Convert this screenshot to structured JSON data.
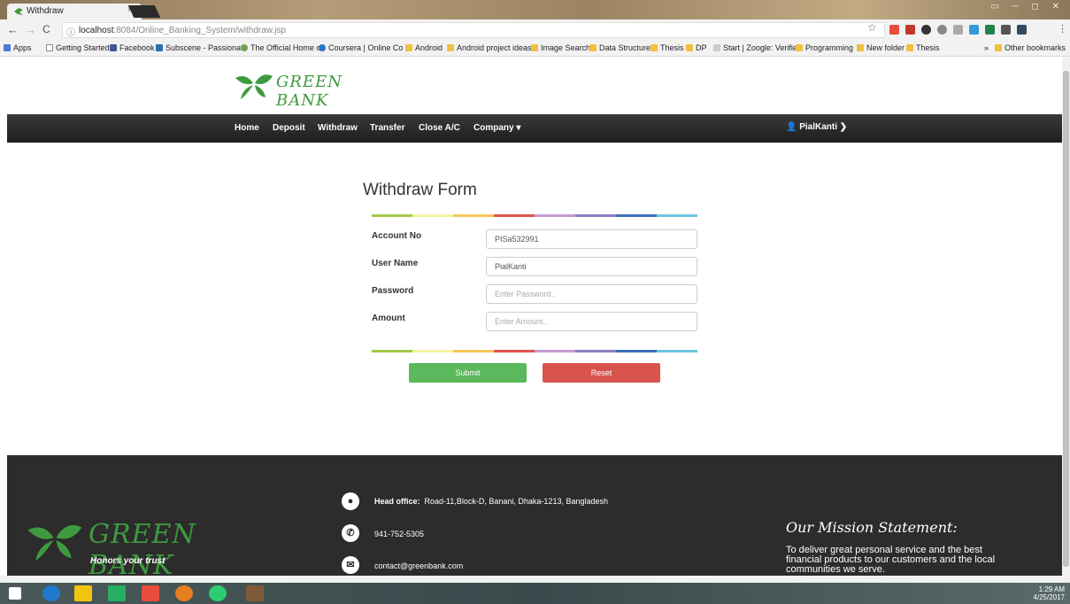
{
  "browser": {
    "tab_title": "Withdraw",
    "tab_close": "×",
    "window_controls": "▭ ─ ◻ ✕",
    "url_host": "localhost",
    "url_path": ":8084/Online_Banking_System/withdraw.jsp",
    "bookmarks": [
      "Apps",
      "Getting Started",
      "Facebook",
      "Subscene - Passionate",
      "The Official Home of",
      "Coursera | Online Co",
      "Android",
      "Android project ideas",
      "Image Search",
      "Data Structure",
      "Thesis",
      "DP",
      "Start | Zoogle: Verifie",
      "Programming",
      "New folder",
      "Thesis"
    ],
    "bookmarks_overflow": "»",
    "other_bookmarks": "Other bookmarks"
  },
  "header": {
    "logo_text": "GREEN BANK"
  },
  "nav": {
    "items": [
      "Home",
      "Deposit",
      "Withdraw",
      "Transfer",
      "Close A/C",
      "Company ▾"
    ],
    "user": "PialKanti ❯"
  },
  "form": {
    "title": "Withdraw Form",
    "fields": [
      {
        "label": "Account No",
        "value": "PISa532991",
        "placeholder": ""
      },
      {
        "label": "User Name",
        "value": "PialKanti",
        "placeholder": ""
      },
      {
        "label": "Password",
        "value": "",
        "placeholder": "Enter Password.."
      },
      {
        "label": "Amount",
        "value": "",
        "placeholder": "Enter Amount.."
      }
    ],
    "submit_label": "Submit",
    "reset_label": "Reset"
  },
  "footer": {
    "logo_text": "GREEN BANK",
    "tagline": "Honors your trust",
    "head_office_label": "Head office:",
    "head_office_address": "Road-11,Block-D, Banani, Dhaka-1213, Bangladesh",
    "phone": "941-752-5305",
    "email": "contact@greenbank.com",
    "mission_title": "Our Mission Statement:",
    "mission_text": "To deliver great personal service and the best financial products to our customers and the local communities we serve."
  },
  "taskbar": {
    "time": "1:29 AM",
    "date": "4/25/2017"
  },
  "colors": {
    "brand_green": "#3f9a3f",
    "submit": "#5cb85c",
    "reset": "#d9534f",
    "navbar": "#222222",
    "footer": "#2c2c2c",
    "divider": [
      "#a3c94a",
      "#f3f3a0",
      "#f7c55a",
      "#e0534f",
      "#c79ad6",
      "#8e7cc3",
      "#3d6fb6",
      "#6fc4e0"
    ]
  }
}
